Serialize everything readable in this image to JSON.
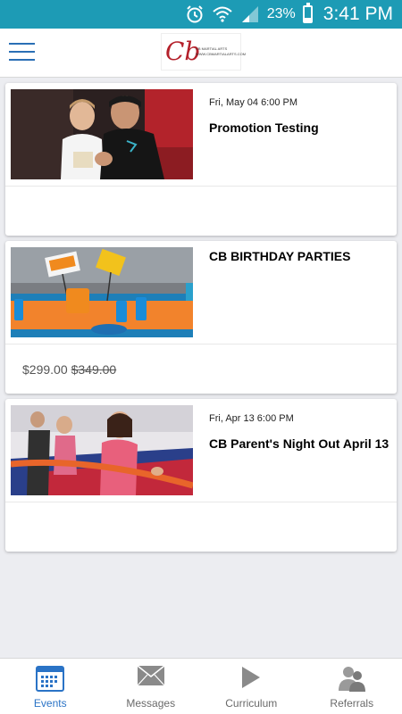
{
  "status_bar": {
    "time": "3:41 PM",
    "battery_percent": "23%",
    "battery_level": 0.23,
    "icons": [
      "alarm-icon",
      "wifi-icon",
      "signal-icon",
      "battery-icon"
    ]
  },
  "header": {
    "menu_icon": "hamburger-menu-icon",
    "logo_mark": "Cb",
    "logo_line1": "CB MARTIAL ARTS",
    "logo_line2": "WWW.CBMARTIALARTS.COM"
  },
  "events": [
    {
      "date": "Fri, May 04 6:00 PM",
      "title": "Promotion Testing",
      "image": "martial-arts-promotion-photo"
    },
    {
      "date": "",
      "title": "CB BIRTHDAY PARTIES",
      "image": "birthday-party-table-photo",
      "price": "$299.00",
      "original_price": "$349.00"
    },
    {
      "date": "Fri, Apr 13 6:00 PM",
      "title": "CB Parent's Night Out April 13",
      "image": "tug-of-war-kids-photo"
    }
  ],
  "bottom_nav": {
    "items": [
      {
        "label": "Events",
        "icon": "calendar-icon",
        "active": true
      },
      {
        "label": "Messages",
        "icon": "envelope-icon",
        "active": false
      },
      {
        "label": "Curriculum",
        "icon": "play-icon",
        "active": false
      },
      {
        "label": "Referrals",
        "icon": "people-icon",
        "active": false
      }
    ]
  },
  "colors": {
    "status_bar": "#1d9bb5",
    "accent": "#2a73c6",
    "background": "#ecedf1",
    "logo_red": "#b4202a"
  }
}
